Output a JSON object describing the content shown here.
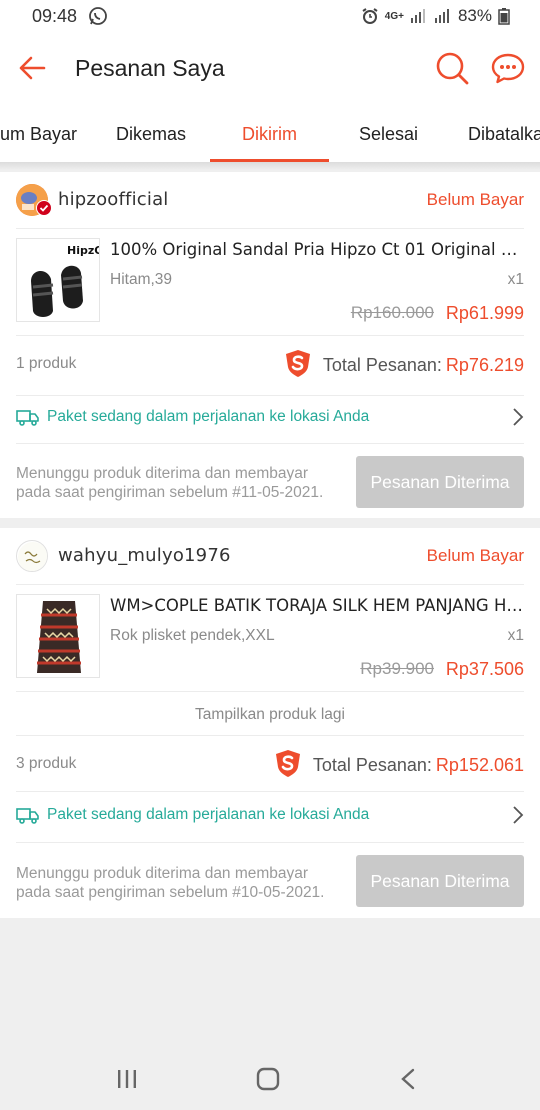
{
  "status_bar": {
    "time": "09:48",
    "battery": "83%",
    "network": "4G+"
  },
  "header": {
    "title": "Pesanan Saya"
  },
  "tabs": [
    {
      "label": "Belum Bayar",
      "active": false
    },
    {
      "label": "Dikemas",
      "active": false
    },
    {
      "label": "Dikirim",
      "active": true
    },
    {
      "label": "Selesai",
      "active": false
    },
    {
      "label": "Dibatalkan",
      "active": false
    }
  ],
  "orders": [
    {
      "shop": "hipzoofficial",
      "status": "Belum Bayar",
      "product": {
        "name": "100% Original Sandal Pria Hipzo Ct 01 Original Se...",
        "variant": "Hitam,39",
        "qty": "x1",
        "price_old": "Rp160.000",
        "price_new": "Rp61.999",
        "thumb_brand": "HipzO"
      },
      "count": "1 produk",
      "total_label": "Total Pesanan:",
      "total_value": "Rp76.219",
      "shipping": "Paket sedang dalam perjalanan ke lokasi Anda",
      "waiting": "Menunggu produk diterima dan membayar pada saat pengiriman sebelum #11-05-2021.",
      "button": "Pesanan Diterima"
    },
    {
      "shop": "wahyu_mulyo1976",
      "status": "Belum Bayar",
      "product": {
        "name": "WM>COPLE BATIK TORAJA SILK HEM PANJANG HE...",
        "variant": "Rok plisket pendek,XXL",
        "qty": "x1",
        "price_old": "Rp39.900",
        "price_new": "Rp37.506"
      },
      "more": "Tampilkan produk lagi",
      "count": "3 produk",
      "total_label": "Total Pesanan:",
      "total_value": "Rp152.061",
      "shipping": "Paket sedang dalam perjalanan ke lokasi Anda",
      "waiting": "Menunggu produk diterima dan membayar pada saat pengiriman sebelum #10-05-2021.",
      "button": "Pesanan Diterima"
    }
  ],
  "colors": {
    "accent": "#ee4d2d",
    "ship": "#26aa99",
    "disabled": "#c9c9c9"
  }
}
